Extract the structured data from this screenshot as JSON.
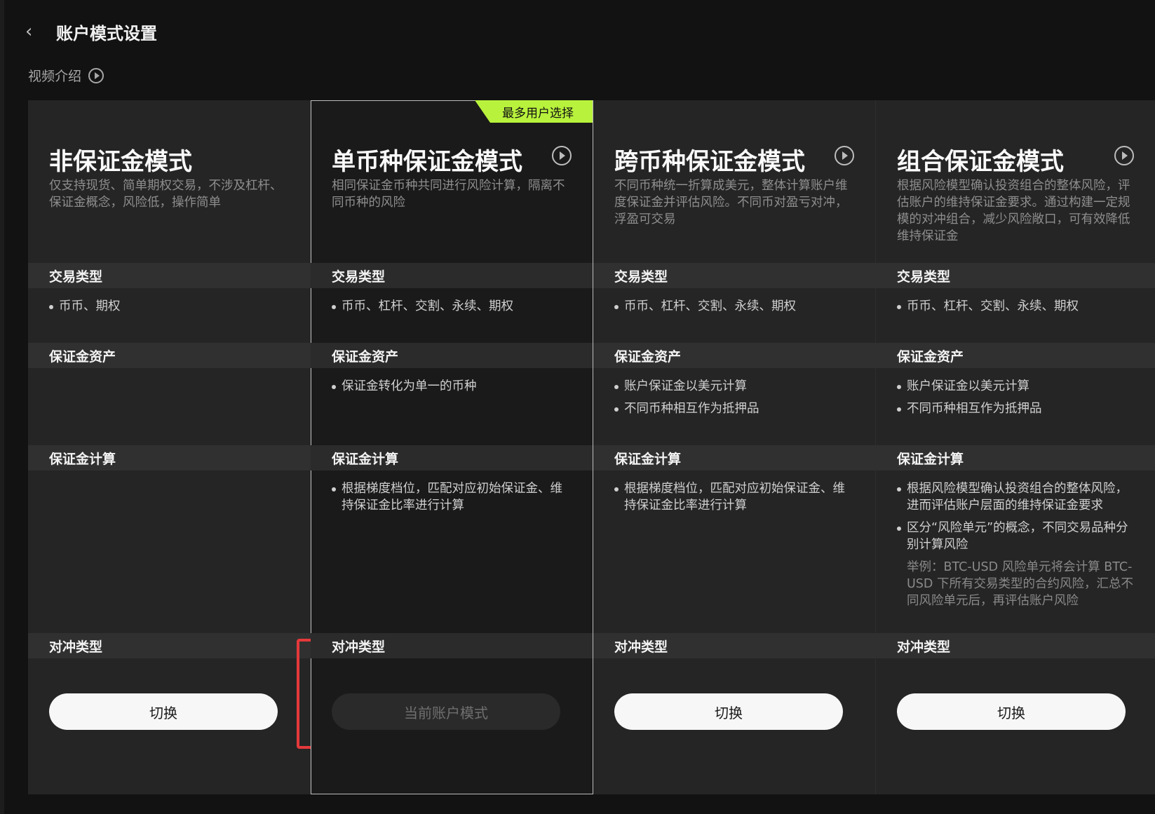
{
  "header": {
    "back_icon": "chevron-left-icon",
    "title": "账户模式设置"
  },
  "video": {
    "label": "视频介绍",
    "icon": "play-circle-icon"
  },
  "colors": {
    "accent_tag": "#b8f23c",
    "highlight_box": "#e5393b"
  },
  "sections": {
    "trade_type": "交易类型",
    "margin_assets": "保证金资产",
    "margin_calc": "保证金计算",
    "hedge_type": "对冲类型"
  },
  "modes": [
    {
      "title": "非保证金模式",
      "desc": "仅支持现货、简单期权交易，不涉及杠杆、保证金概念，风险低，操作简单",
      "trade_types": [
        "币币、期权"
      ],
      "margin_assets": [],
      "margin_calc": [],
      "button": "切换"
    },
    {
      "title": "单币种保证金模式",
      "tag": "最多用户选择",
      "desc": "相同保证金币种共同进行风险计算，隔离不同币种的风险",
      "trade_types": [
        "币币、杠杆、交割、永续、期权"
      ],
      "margin_assets": [
        "保证金转化为单一的币种"
      ],
      "margin_calc": [
        "根据梯度档位，匹配对应初始保证金、维持保证金比率进行计算"
      ],
      "button": "当前账户模式"
    },
    {
      "title": "跨币种保证金模式",
      "desc": "不同币种统一折算成美元，整体计算账户维度保证金并评估风险。不同币对盈亏对冲，浮盈可交易",
      "trade_types": [
        "币币、杠杆、交割、永续、期权"
      ],
      "margin_assets": [
        "账户保证金以美元计算",
        "不同币种相互作为抵押品"
      ],
      "margin_calc": [
        "根据梯度档位，匹配对应初始保证金、维持保证金比率进行计算"
      ],
      "button": "切换"
    },
    {
      "title": "组合保证金模式",
      "desc": "根据风险模型确认投资组合的整体风险，评估账户的维持保证金要求。通过构建一定规模的对冲组合，减少风险敞口，可有效降低维持保证金",
      "trade_types": [
        "币币、杠杆、交割、永续、期权"
      ],
      "margin_assets": [
        "账户保证金以美元计算",
        "不同币种相互作为抵押品"
      ],
      "margin_calc": [
        "根据风险模型确认投资组合的整体风险，进而评估账户层面的维持保证金要求",
        "区分“风险单元”的概念，不同交易品种分别计算风险"
      ],
      "margin_calc_note": "举例：BTC-USD 风险单元将会计算 BTC-USD 下所有交易类型的合约风险，汇总不同风险单元后，再评估账户风险",
      "button": "切换"
    }
  ]
}
